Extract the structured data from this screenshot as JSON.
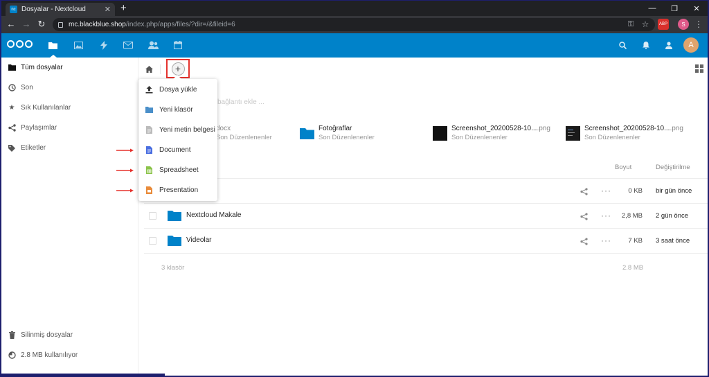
{
  "browser": {
    "tab_title": "Dosyalar - Nextcloud",
    "favicon_text": "nc",
    "url_host": "mc.blackblue.shop",
    "url_path": "/index.php/apps/files/?dir=/&fileid=6",
    "ext_abp": "ABP",
    "profile_initial": "S"
  },
  "header": {
    "avatar_initial": "A",
    "apps": [
      "files-icon",
      "photos-icon",
      "activity-icon",
      "mail-icon",
      "contacts-icon",
      "calendar-icon"
    ]
  },
  "sidebar": {
    "items": [
      {
        "label": "Tüm dosyalar",
        "icon": "folder-icon"
      },
      {
        "label": "Son",
        "icon": "clock-icon"
      },
      {
        "label": "Sık Kullanılanlar",
        "icon": "star-icon"
      },
      {
        "label": "Paylaşımlar",
        "icon": "share-icon"
      },
      {
        "label": "Etiketler",
        "icon": "tag-icon"
      }
    ],
    "footer": [
      {
        "label": "Silinmiş dosyalar",
        "icon": "trash-icon"
      },
      {
        "label": "2.8 MB kullanılıyor",
        "icon": "pie-icon"
      }
    ]
  },
  "main": {
    "comment_placeholder": "bağlantı ekle ...",
    "recent": [
      {
        "name": "",
        "ext": "docx",
        "sub": "Son Düzenlenenler"
      },
      {
        "name": "Fotoğraflar",
        "ext": "",
        "sub": "Son Düzenlenenler"
      },
      {
        "name": "Screenshot_20200528-10...",
        "ext": ".png",
        "sub": "Son Düzenlenenler"
      },
      {
        "name": "Screenshot_20200528-10...",
        "ext": ".png",
        "sub": "Son Düzenlenenler"
      }
    ],
    "columns": {
      "size": "Boyut",
      "modified": "Değiştirilme"
    },
    "rows": [
      {
        "name": "",
        "size": "0 KB",
        "modified": "bir gün önce"
      },
      {
        "name": "Nextcloud Makale",
        "size": "2,8 MB",
        "modified": "2 gün önce"
      },
      {
        "name": "Videolar",
        "size": "7 KB",
        "modified": "3 saat önce"
      }
    ],
    "more_glyph": "···",
    "summary": {
      "count": "3 klasör",
      "size": "2.8 MB"
    }
  },
  "new_menu": {
    "items": [
      {
        "label": "Dosya yükle",
        "icon": "upload-icon"
      },
      {
        "label": "Yeni klasör",
        "icon": "folder-icon"
      },
      {
        "label": "Yeni metin belgesi",
        "icon": "text-file-icon"
      },
      {
        "label": "Document",
        "icon": "document-icon"
      },
      {
        "label": "Spreadsheet",
        "icon": "spreadsheet-icon"
      },
      {
        "label": "Presentation",
        "icon": "presentation-icon"
      }
    ]
  },
  "colors": {
    "brand": "#0082c9",
    "highlight": "#e5322d",
    "doc": "#4a6ee0",
    "sheet": "#8bc34a",
    "pres": "#e98b3a"
  }
}
